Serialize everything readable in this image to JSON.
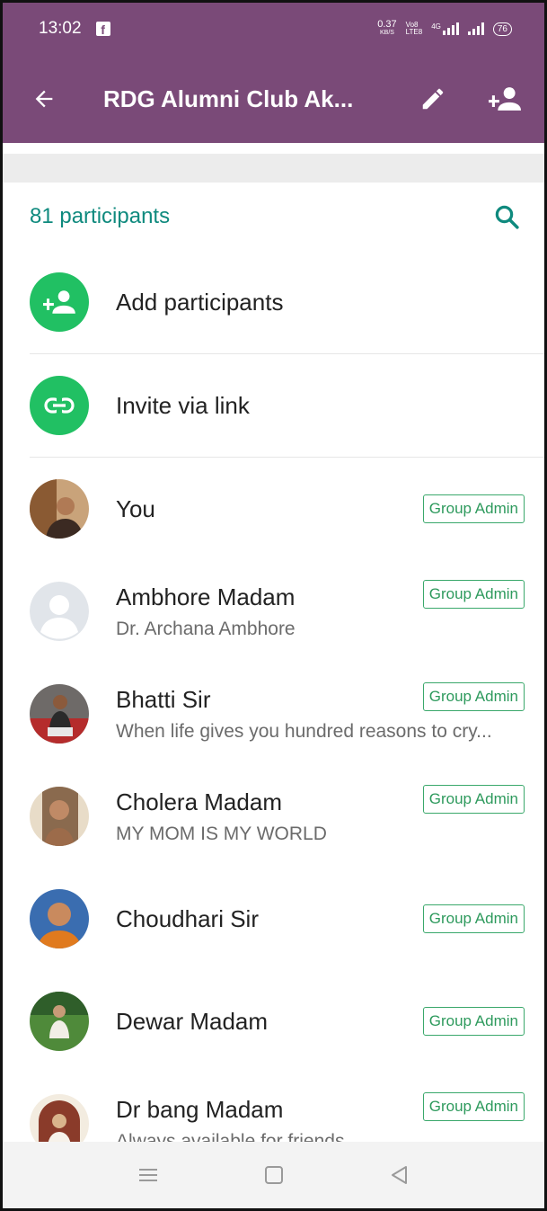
{
  "status_bar": {
    "time": "13:02",
    "notification_icon": "facebook-icon",
    "net_speed_value": "0.37",
    "net_speed_unit": "KB/S",
    "volte_line1": "Vo8",
    "volte_line2": "LTE8",
    "network_type": "4G",
    "battery": "76"
  },
  "appbar": {
    "title": "RDG Alumni Club Ak...",
    "back_icon": "arrow-left-icon",
    "edit_icon": "pencil-icon",
    "add_icon": "add-person-icon"
  },
  "participants": {
    "count_label": "81 participants",
    "search_icon": "search-icon"
  },
  "actions": [
    {
      "label": "Add participants",
      "icon": "add-person-icon"
    },
    {
      "label": "Invite via link",
      "icon": "link-icon"
    }
  ],
  "members": [
    {
      "name": "You",
      "subtitle": "",
      "badge": "Group Admin"
    },
    {
      "name": "Ambhore Madam",
      "subtitle": "Dr. Archana Ambhore",
      "badge": "Group Admin"
    },
    {
      "name": "Bhatti Sir",
      "subtitle": "When life gives you hundred reasons to cry...",
      "badge": "Group Admin"
    },
    {
      "name": "Cholera Madam",
      "subtitle": "MY MOM IS MY WORLD",
      "badge": "Group Admin"
    },
    {
      "name": "Choudhari Sir",
      "subtitle": "",
      "badge": "Group Admin"
    },
    {
      "name": "Dewar Madam",
      "subtitle": "",
      "badge": "Group Admin"
    },
    {
      "name": "Dr bang Madam",
      "subtitle": "Always available for friends",
      "badge": "Group Admin"
    }
  ],
  "colors": {
    "header": "#7a4a78",
    "accent_teal": "#0f8a7e",
    "action_green": "#21c063",
    "badge_green": "#2e9a5d"
  }
}
